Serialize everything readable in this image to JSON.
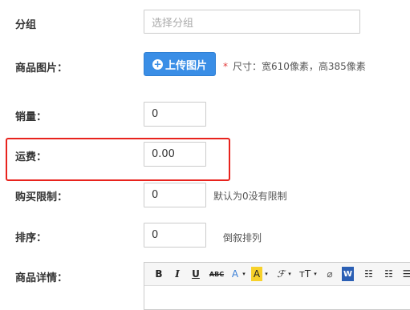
{
  "fields": {
    "group": {
      "label": "分组",
      "placeholder": "选择分组"
    },
    "image": {
      "label": "商品图片：",
      "upload_label": "上传图片",
      "hint_mark": "*",
      "hint": "尺寸：宽610像素，高385像素"
    },
    "sales": {
      "label": "销量：",
      "value": "0"
    },
    "shipping": {
      "label": "运费：",
      "value": "0.00"
    },
    "purchase_limit": {
      "label": "购买限制：",
      "value": "0",
      "hint": "默认为0没有限制"
    },
    "sort": {
      "label": "排序：",
      "value": "0",
      "hint": "倒叙排列"
    },
    "details": {
      "label": "商品详情："
    }
  },
  "toolbar": {
    "bold": "B",
    "italic": "I",
    "underline": "U",
    "strikethrough": "ABC",
    "font_color": "A",
    "highlight": "A",
    "font_family": "ℱ",
    "font_size": "тT",
    "clear_format": "⌀",
    "word_paste": "W",
    "ordered_list": "☷",
    "unordered_list": "☷",
    "more": "☰"
  },
  "colors": {
    "accent": "#3a8ee6",
    "highlight_border": "#e8231d",
    "required_mark": "#e23b3b",
    "font_color_icon": "#3a7fd6",
    "highlight_icon": "#f7d12a"
  }
}
